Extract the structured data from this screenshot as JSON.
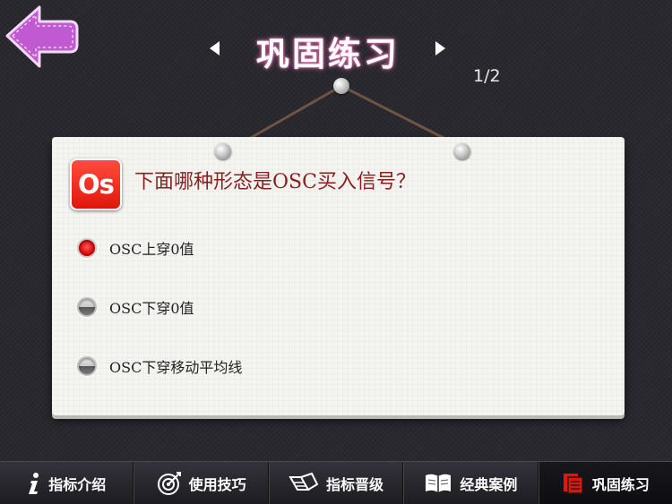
{
  "header": {
    "title": "巩固练习",
    "page_counter": "1/2"
  },
  "question": {
    "logo_text": "Os",
    "text": "下面哪种形态是OSC买入信号？",
    "options": [
      {
        "label": "OSC上穿0值",
        "selected": true
      },
      {
        "label": "OSC下穿0值",
        "selected": false
      },
      {
        "label": "OSC下穿移动平均线",
        "selected": false
      }
    ]
  },
  "tabs": [
    {
      "label": "指标介绍",
      "icon": "info-icon",
      "active": false
    },
    {
      "label": "使用技巧",
      "icon": "target-icon",
      "active": false
    },
    {
      "label": "指标晋级",
      "icon": "upgrade-icon",
      "active": false
    },
    {
      "label": "经典案例",
      "icon": "book-icon",
      "active": false
    },
    {
      "label": "巩固练习",
      "icon": "pages-icon",
      "active": true
    }
  ],
  "colors": {
    "back_arrow": "#c15ad2",
    "accent_red": "#e0160c",
    "question_text": "#8b1f1f"
  }
}
